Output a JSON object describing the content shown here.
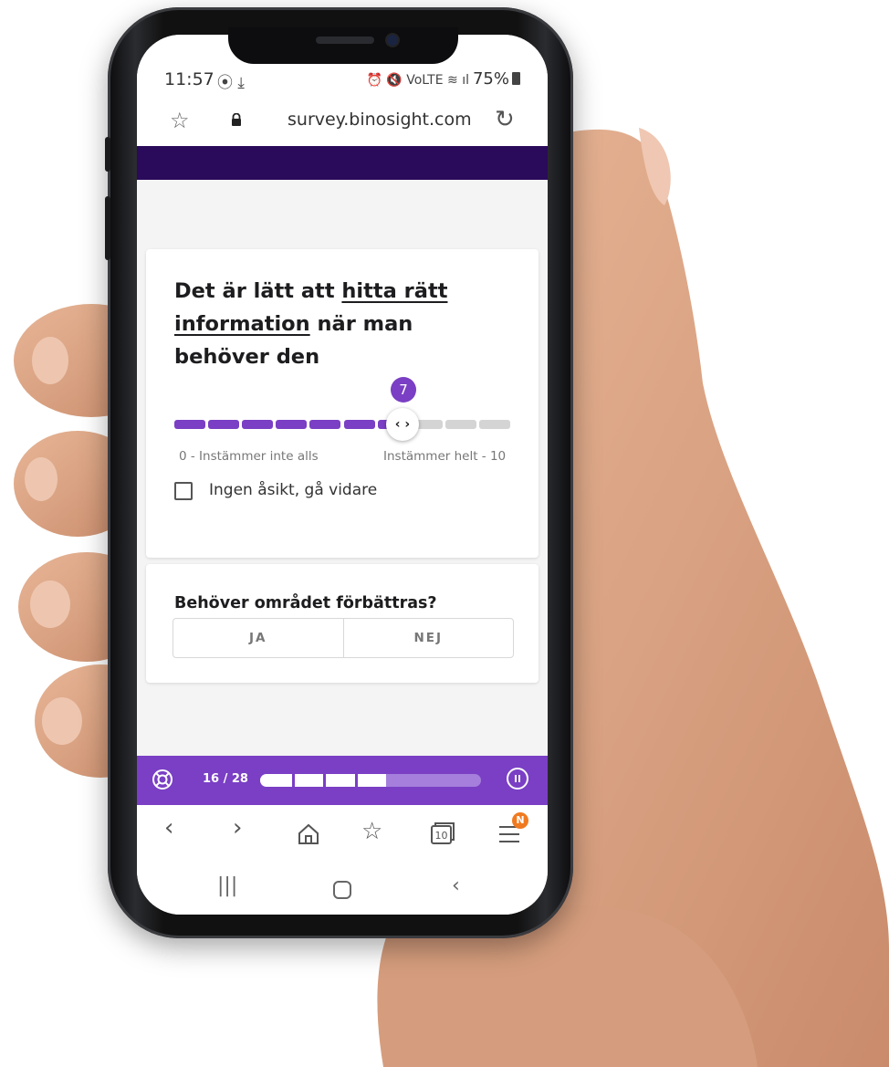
{
  "status_bar": {
    "time": "11:57",
    "left_icons": "⦿ ⤓",
    "right_icons": "⏰ 🔇 VoLTE ≋ ıl",
    "battery": "75%"
  },
  "browser": {
    "url": "survey.binosight.com",
    "tab_count": "10",
    "menu_badge": "N"
  },
  "question1": {
    "text_before": "Det är lätt att ",
    "text_link": "hitta rätt information",
    "text_after": " när man behöver den",
    "slider_value": "7",
    "slider_handle": "‹ ›",
    "slider_min": 0,
    "slider_max": 10,
    "scale_min_label": "0 - Instämmer inte alls",
    "scale_max_label": "Instämmer helt - 10",
    "no_opinion_label": "Ingen åsikt, gå vidare",
    "no_opinion_checked": false
  },
  "question2": {
    "text": "Behöver området förbättras?",
    "option_yes": "JA",
    "option_no": "NEJ"
  },
  "progress": {
    "label": "16 / 28",
    "current": 16,
    "total": 28
  },
  "colors": {
    "accent": "#7a3fc4",
    "brand_bar": "#2a0a5a",
    "slider_empty": "#d4d4d4",
    "badge": "#f07a20"
  }
}
